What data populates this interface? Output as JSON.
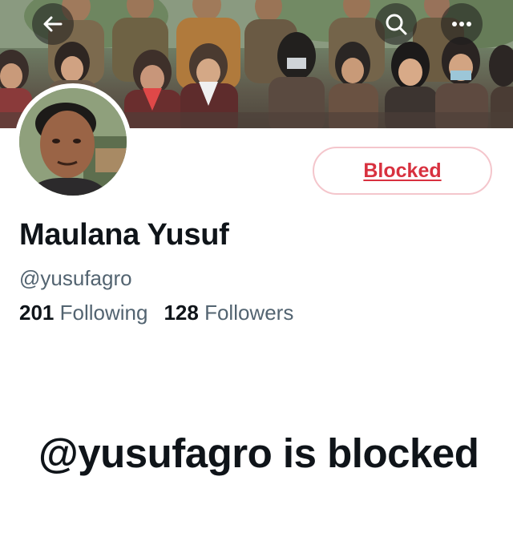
{
  "header": {
    "back_icon": "arrow-left-icon",
    "search_icon": "search-icon",
    "more_icon": "more-horizontal-icon"
  },
  "profile": {
    "display_name": "Maulana Yusuf",
    "handle": "@yusufagro",
    "following_count": "201",
    "following_label": "Following",
    "followers_count": "128",
    "followers_label": "Followers",
    "blocked_button_label": "Blocked"
  },
  "blocked_notice": {
    "heading": "@yusufagro is blocked"
  },
  "colors": {
    "blocked_red": "#d8313f",
    "blocked_border": "#f4c6cc",
    "primary_text": "#0f1419",
    "secondary_text": "#536471"
  }
}
